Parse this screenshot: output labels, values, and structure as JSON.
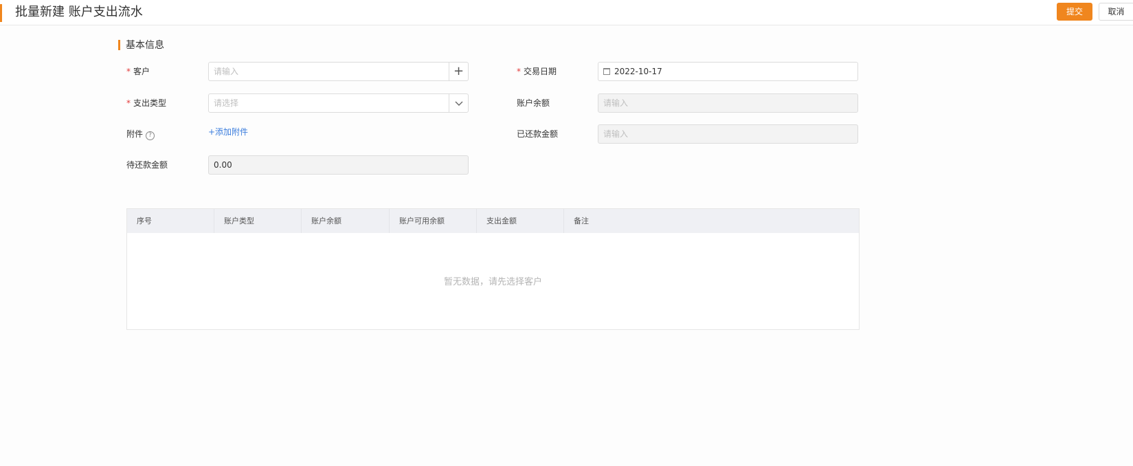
{
  "header": {
    "title": "批量新建 账户支出流水",
    "submit_label": "提交",
    "cancel_label": "取消",
    "accent_color": "#f0861e"
  },
  "section": {
    "title": "基本信息"
  },
  "form": {
    "customer": {
      "label": "客户",
      "placeholder": "请输入",
      "addon_icon": "plus-icon"
    },
    "trade_date": {
      "label": "交易日期",
      "value": "2022-10-17",
      "icon": "calendar-icon"
    },
    "expense_type": {
      "label": "支出类型",
      "placeholder": "请选择",
      "addon_icon": "chevron-down-icon"
    },
    "account_balance": {
      "label": "账户余额",
      "placeholder": "请输入"
    },
    "attachment": {
      "label": "附件",
      "help_icon": "question-circle-icon",
      "link": "+添加附件"
    },
    "repaid_amount": {
      "label": "已还款金额",
      "placeholder": "请输入"
    },
    "pending_amount": {
      "label": "待还款金额",
      "value": "0.00"
    }
  },
  "table": {
    "columns": [
      "序号",
      "账户类型",
      "账户余额",
      "账户可用余额",
      "支出金额",
      "备注"
    ],
    "empty_text": "暂无数据，请先选择客户"
  }
}
